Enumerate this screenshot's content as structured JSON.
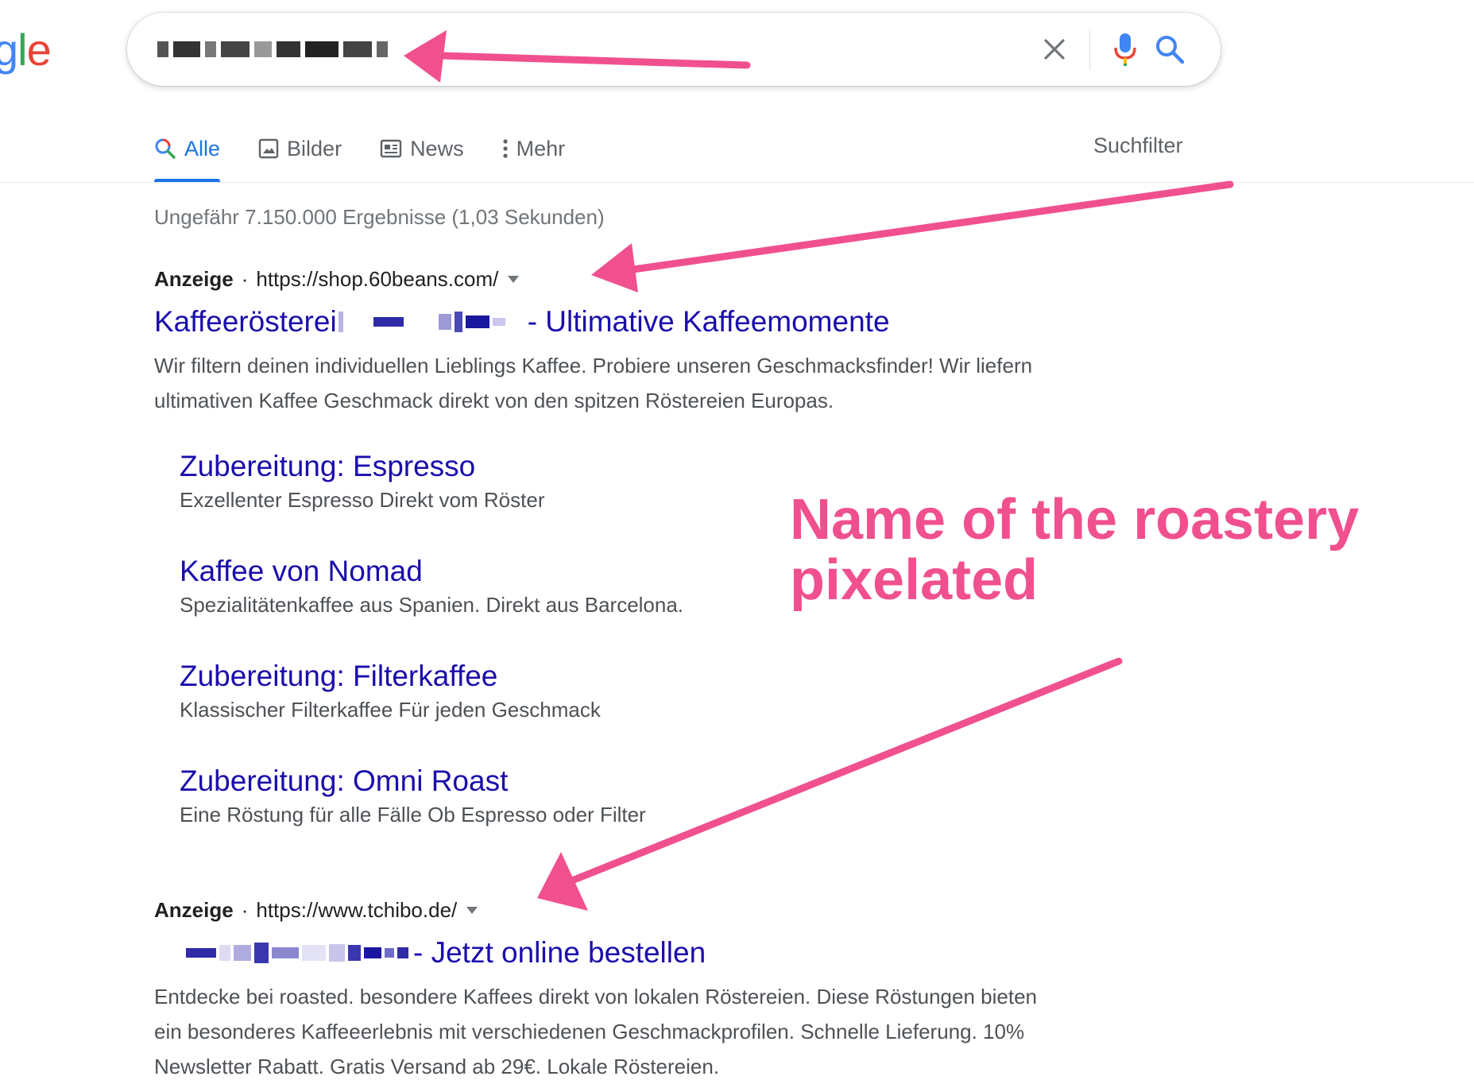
{
  "logo": {
    "text_g": "g",
    "text_l": "l",
    "text_e": "e"
  },
  "search": {
    "clear_icon": "close-icon",
    "mic_icon": "microphone-icon",
    "search_icon": "search-icon"
  },
  "tabs": [
    {
      "label": "Alle",
      "icon": "search-icon",
      "active": true
    },
    {
      "label": "Bilder",
      "icon": "image-icon"
    },
    {
      "label": "News",
      "icon": "newspaper-icon"
    },
    {
      "label": "Mehr",
      "icon": "more-vertical-icon"
    }
  ],
  "search_tools": "Suchfilter",
  "result_stats": "Ungefähr 7.150.000 Ergebnisse (1,03 Sekunden)",
  "ads": [
    {
      "label": "Anzeige",
      "url": "https://shop.60beans.com/",
      "title_prefix": "Kaffeerösterei",
      "title_suffix": "- Ultimative Kaffeemomente",
      "description_lines": [
        "Wir filtern deinen individuellen Lieblings Kaffee. Probiere unseren Geschmacksfinder! Wir liefern",
        "ultimativen Kaffee Geschmack direkt von den spitzen Röstereien Europas."
      ],
      "sitelinks": [
        {
          "title": "Zubereitung: Espresso",
          "desc": "Exzellenter Espresso Direkt vom Röster"
        },
        {
          "title": "Kaffee von Nomad",
          "desc": "Spezialitätenkaffee aus Spanien. Direkt aus Barcelona."
        },
        {
          "title": "Zubereitung: Filterkaffee",
          "desc": "Klassischer Filterkaffee Für jeden Geschmack"
        },
        {
          "title": "Zubereitung: Omni Roast",
          "desc": "Eine Röstung für alle Fälle Ob Espresso oder Filter"
        }
      ]
    },
    {
      "label": "Anzeige",
      "url": "https://www.tchibo.de/",
      "title_suffix": "- Jetzt online bestellen",
      "description_lines": [
        "Entdecke bei roasted. besondere Kaffees direkt von lokalen Röstereien. Diese Röstungen bieten",
        "ein besonderes Kaffeeerlebnis mit verschiedenen Geschmackprofilen. Schnelle Lieferung. 10%",
        "Newsletter Rabatt. Gratis Versand ab 29€. Lokale Röstereien."
      ]
    }
  ],
  "annotation": {
    "line1": "Name of the roastery",
    "line2": "pixelated"
  },
  "colors": {
    "link": "#1a0dab",
    "tab_active": "#1a73e8",
    "annotation": "#f0508e",
    "muted": "#70757a",
    "snippet": "#4d5156"
  }
}
